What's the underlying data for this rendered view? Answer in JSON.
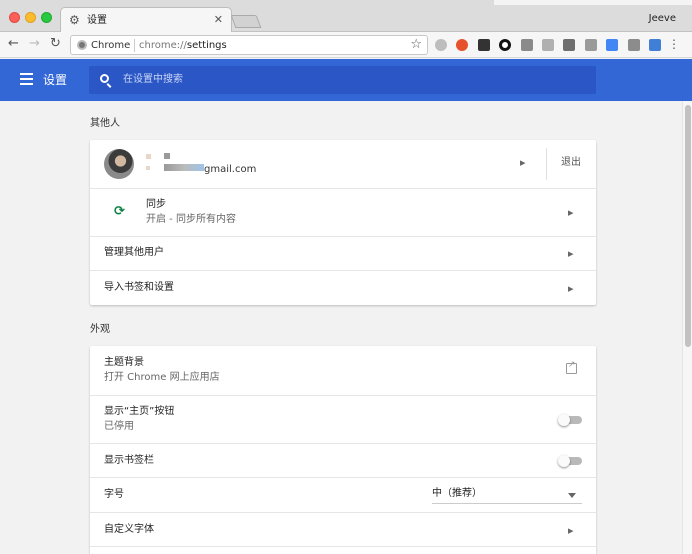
{
  "window": {
    "tab_title": "设置",
    "tab_icon": "gear-icon",
    "profile_name": "Jeeve"
  },
  "toolbar": {
    "chip_label": "Chrome",
    "url_scheme": "chrome://",
    "url_host": "settings",
    "extensions": [
      {
        "icon": "extension-gray-circle-icon",
        "color": "#bdbdbd"
      },
      {
        "icon": "extension-weibo-icon",
        "color": "#e6512b"
      },
      {
        "icon": "extension-qrcode-icon",
        "color": "#333333"
      },
      {
        "icon": "extension-black-ring-icon",
        "color": "#111111"
      },
      {
        "icon": "extension-shield-icon",
        "color": "#8a8a8a"
      },
      {
        "icon": "extension-table-icon",
        "color": "#b0b0b0"
      },
      {
        "icon": "extension-book-icon",
        "color": "#6e6e6e"
      },
      {
        "icon": "extension-note-icon",
        "color": "#9a9a9a"
      },
      {
        "icon": "extension-blue-arrow-icon",
        "color": "#4285f4"
      },
      {
        "icon": "extension-s-icon",
        "color": "#8c8c8c"
      },
      {
        "icon": "extension-jh-icon",
        "color": "#3f7fd8"
      }
    ]
  },
  "header": {
    "title": "设置",
    "search_placeholder": "在设置中搜索",
    "accent_color": "#3367d6"
  },
  "sections": {
    "people": {
      "title": "其他人",
      "account": {
        "email_suffix": "gmail.com",
        "signout_label": "退出"
      },
      "sync": {
        "label": "同步",
        "sub": "开启 - 同步所有内容"
      },
      "manage_users": "管理其他用户",
      "import": "导入书签和设置"
    },
    "appearance": {
      "title": "外观",
      "theme": {
        "label": "主题背景",
        "sub": "打开 Chrome 网上应用店"
      },
      "home_button": {
        "label": "显示“主页”按钮",
        "sub": "已停用",
        "enabled": false
      },
      "bookmarks_bar": {
        "label": "显示书签栏",
        "enabled": false
      },
      "font_size": {
        "label": "字号",
        "value": "中（推荐）"
      },
      "custom_fonts": "自定义字体"
    }
  }
}
